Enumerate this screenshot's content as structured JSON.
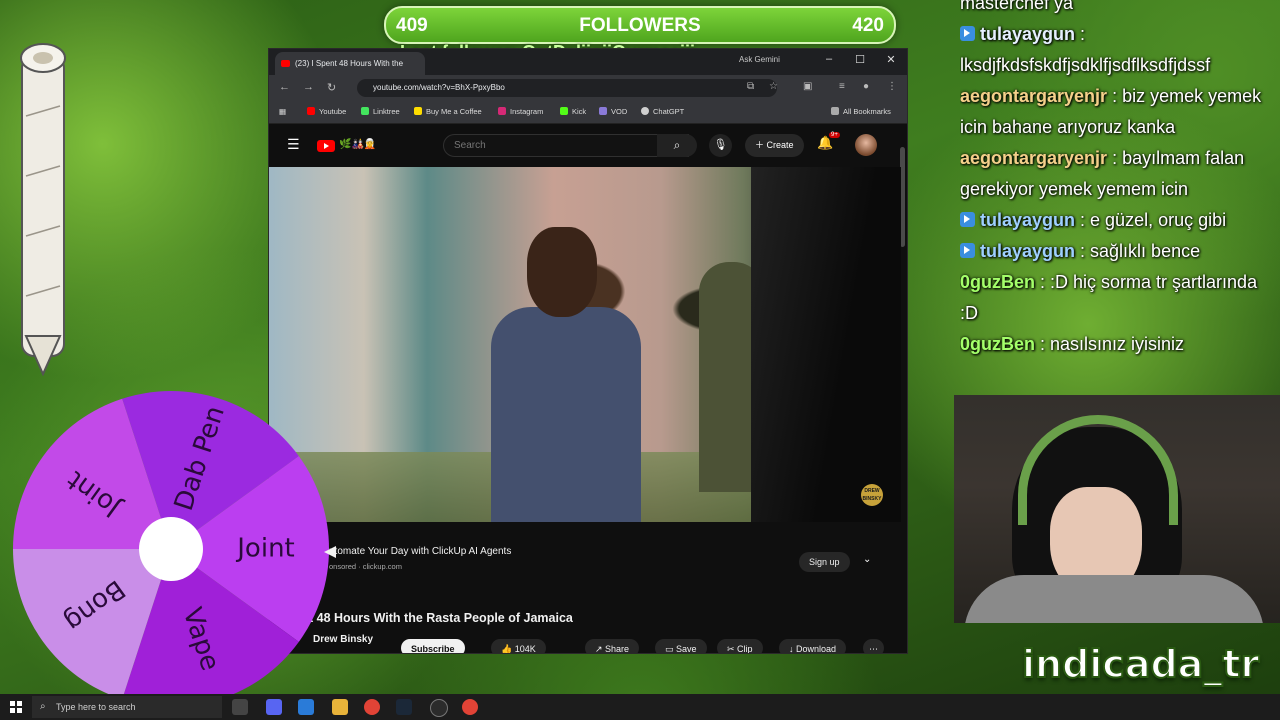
{
  "followers": {
    "current": "409",
    "title": "FOLLOWERS",
    "goal": "420",
    "last_follower": "Last follower: GotDeliigiiGurmesiji"
  },
  "browser": {
    "tab_title": "(23) I Spent 48 Hours With the",
    "ask_gemini": "Ask Gemini",
    "url": "youtube.com/watch?v=BhX-PpxyBbo",
    "bookmarks": [
      "Youtube",
      "Linktree",
      "Buy Me a Coffee",
      "Instagram",
      "Kick",
      "VOD",
      "ChatGPT"
    ],
    "all_bookmarks": "All Bookmarks",
    "colors": {
      "accent": "#ff0000"
    }
  },
  "youtube": {
    "logo_suffix": "🌿🎎🧝",
    "search_placeholder": "Search",
    "create_label": "Create",
    "notification_count": "9+",
    "ad": {
      "title": "utomate Your Day with ClickUp AI Agents",
      "sponsor": "onsored · clickup.com",
      "signup": "Sign up"
    },
    "video_title": "t 48 Hours With the Rasta People of Jamaica",
    "channel": "Drew Binsky",
    "subscribe": "Subscribe",
    "likes": "104K",
    "share": "Share",
    "save": "Save",
    "clip": "Clip",
    "download": "Download",
    "watermark": "DREW BINSKY"
  },
  "wheel": {
    "segments": [
      "Dab Pen",
      "Joint",
      "Vape",
      "Bong",
      "Joint"
    ],
    "colors": [
      "#9b2ae0",
      "#bb3ef0",
      "#a020d8",
      "#c98ee8",
      "#c24ae8"
    ]
  },
  "chat": [
    {
      "user": "",
      "message": "masterchef ya",
      "badge": false,
      "color": "#ffffff"
    },
    {
      "user": "tulayaygun",
      "message": " : lksdjfkdsfskdfjsdklfjsdflksdfjdssf",
      "badge": true,
      "color": "#e6f0ff"
    },
    {
      "user": "aegontargaryenjr",
      "message": " : biz yemek yemek icin bahane arıyoruz kanka",
      "badge": false,
      "color": "#f4d08a"
    },
    {
      "user": "aegontargaryenjr",
      "message": " : bayılmam falan gerekiyor yemek yemem icin",
      "badge": false,
      "color": "#f4d08a"
    },
    {
      "user": "tulayaygun",
      "message": " : e güzel, oruç gibi",
      "badge": true,
      "color": "#9fd0ff"
    },
    {
      "user": "tulayaygun",
      "message": " : sağlıklı bence",
      "badge": true,
      "color": "#9fd0ff"
    },
    {
      "user": "0guzBen",
      "message": " : :D hiç sorma tr şartlarında :D",
      "badge": false,
      "color": "#a4ff6a"
    },
    {
      "user": "0guzBen",
      "message": " : nasılsınız iyisiniz",
      "badge": false,
      "color": "#a4ff6a"
    }
  ],
  "channel_name": "indicada_tr",
  "taskbar": {
    "search_placeholder": "Type here to search"
  }
}
